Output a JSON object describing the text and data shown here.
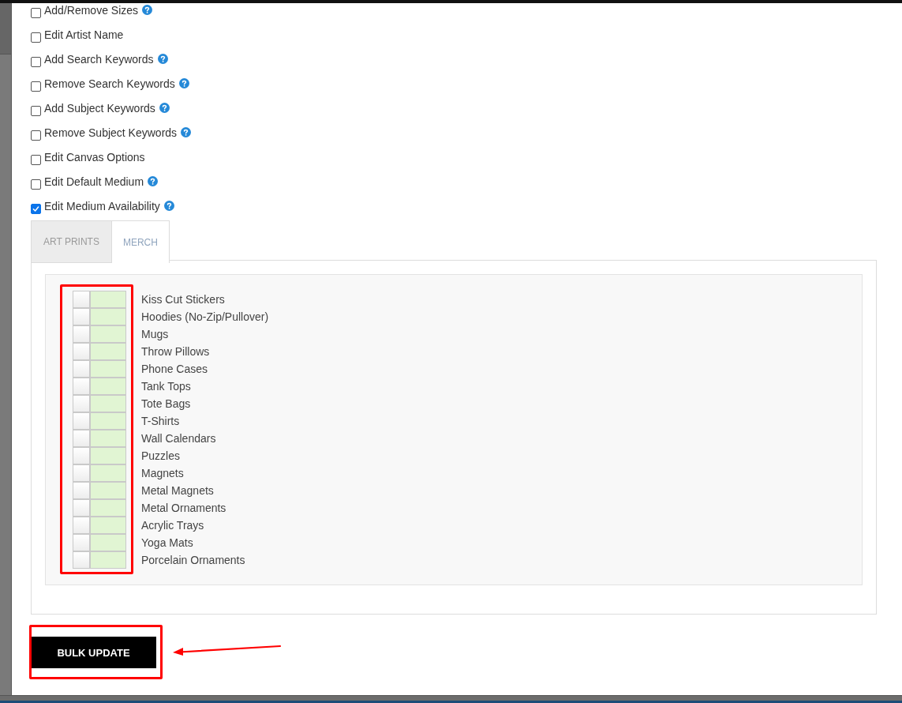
{
  "options": [
    {
      "label": "Add/Remove Sizes",
      "checked": false,
      "help": true
    },
    {
      "label": "Edit Artist Name",
      "checked": false,
      "help": false
    },
    {
      "label": "Add Search Keywords",
      "checked": false,
      "help": true
    },
    {
      "label": "Remove Search Keywords",
      "checked": false,
      "help": true
    },
    {
      "label": "Add Subject Keywords",
      "checked": false,
      "help": true
    },
    {
      "label": "Remove Subject Keywords",
      "checked": false,
      "help": true
    },
    {
      "label": "Edit Canvas Options",
      "checked": false,
      "help": false
    },
    {
      "label": "Edit Default Medium",
      "checked": false,
      "help": true
    },
    {
      "label": "Edit Medium Availability",
      "checked": true,
      "help": true
    }
  ],
  "tabs": [
    {
      "label": "ART PRINTS",
      "selected": false
    },
    {
      "label": "MERCH",
      "selected": true
    }
  ],
  "merch_items": [
    {
      "label": "Kiss Cut Stickers",
      "on": true
    },
    {
      "label": "Hoodies (No-Zip/Pullover)",
      "on": true
    },
    {
      "label": "Mugs",
      "on": true
    },
    {
      "label": "Throw Pillows",
      "on": true
    },
    {
      "label": "Phone Cases",
      "on": true
    },
    {
      "label": "Tank Tops",
      "on": true
    },
    {
      "label": "Tote Bags",
      "on": true
    },
    {
      "label": "T-Shirts",
      "on": true
    },
    {
      "label": "Wall Calendars",
      "on": true
    },
    {
      "label": "Puzzles",
      "on": true
    },
    {
      "label": "Magnets",
      "on": true
    },
    {
      "label": "Metal Magnets",
      "on": true
    },
    {
      "label": "Metal Ornaments",
      "on": true
    },
    {
      "label": "Acrylic Trays",
      "on": true
    },
    {
      "label": "Yoga Mats",
      "on": true
    },
    {
      "label": "Porcelain Ornaments",
      "on": true
    }
  ],
  "button": {
    "label": "BULK UPDATE"
  }
}
